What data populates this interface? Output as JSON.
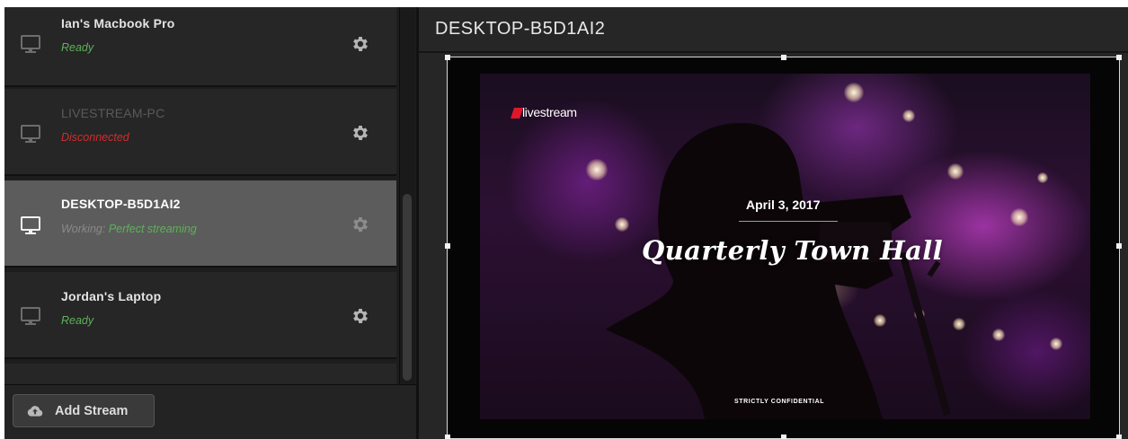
{
  "streams": [
    {
      "name": "Ian's Macbook Pro",
      "status": "Ready"
    },
    {
      "name": "LIVESTREAM-PC",
      "status": "Disconnected"
    },
    {
      "name": "DESKTOP-B5D1AI2",
      "status_label": "Working:",
      "status": "Perfect streaming"
    },
    {
      "name": "Jordan's Laptop",
      "status": "Ready"
    }
  ],
  "add_stream": {
    "label": "Add Stream",
    "icon": "cloud-upload-icon"
  },
  "preview": {
    "title": "DESKTOP-B5D1AI2",
    "slide": {
      "logo_text": "livestream",
      "date": "April 3, 2017",
      "title": "Quarterly Town Hall",
      "footer": "STRICTLY CONFIDENTIAL"
    }
  },
  "colors": {
    "ready": "#5eb15b",
    "disconnected": "#d72a2a",
    "selected_row": "#5c5c5c",
    "logo_red": "#e0162b"
  }
}
